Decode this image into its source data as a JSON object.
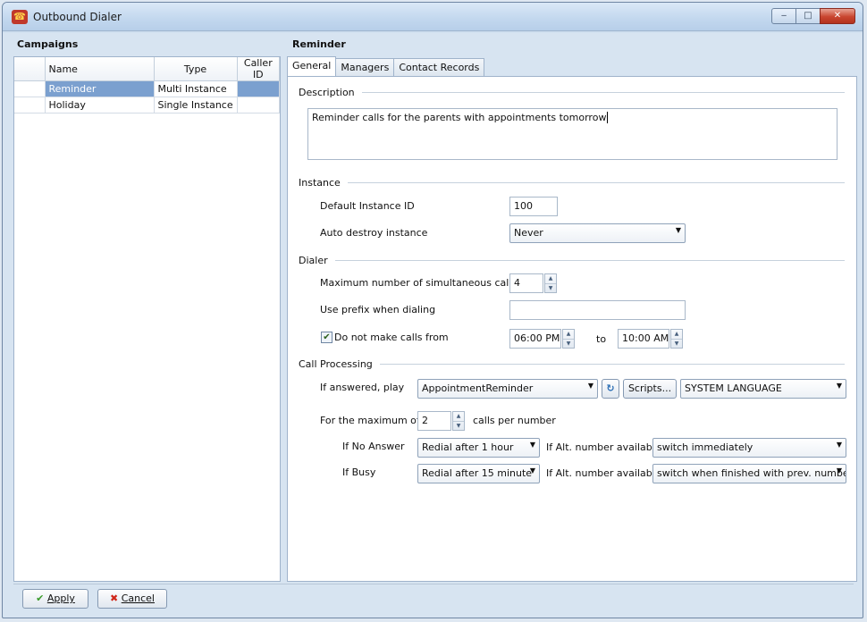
{
  "window": {
    "title": "Outbound Dialer",
    "controls": {
      "minimize": "‒",
      "maximize": "□",
      "close": "✕"
    }
  },
  "campaigns": {
    "heading": "Campaigns",
    "columns": [
      "Name",
      "Type",
      "Caller ID"
    ],
    "rows": [
      {
        "name": "Reminder",
        "type": "Multi Instance",
        "caller_id": ""
      },
      {
        "name": "Holiday",
        "type": "Single Instance",
        "caller_id": ""
      }
    ]
  },
  "detail": {
    "heading": "Reminder",
    "tabs": [
      "General",
      "Managers",
      "Contact Records"
    ],
    "description_group": "Description",
    "description_text": "Reminder calls for the parents with appointments tomorrow",
    "instance_group": "Instance",
    "default_instance_label": "Default Instance ID",
    "default_instance_value": "100",
    "auto_destroy_label": "Auto destroy instance",
    "auto_destroy_value": "Never",
    "dialer_group": "Dialer",
    "max_calls_label": "Maximum number of simultaneous calls",
    "max_calls_value": "4",
    "prefix_label": "Use prefix when dialing",
    "prefix_value": "",
    "no_calls_label": "Do not make calls from",
    "no_calls_checked": true,
    "from_time": "06:00 PM",
    "to_label": "to",
    "to_time": "10:00 AM",
    "call_processing_group": "Call Processing",
    "if_answered_label": "If answered, play",
    "answered_script": "AppointmentReminder",
    "scripts_button": "Scripts...",
    "language_value": "SYSTEM LANGUAGE",
    "max_of_label": "For the maximum of",
    "max_of_value": "2",
    "calls_per_number": "calls per number",
    "no_answer_label": "If No Answer",
    "no_answer_value": "Redial after 1 hour",
    "alt_number_label": "If Alt. number available",
    "no_answer_alt_value": "switch immediately",
    "busy_label": "If Busy",
    "busy_value": "Redial after 15 minute",
    "busy_alt_label": "If Alt. number available",
    "busy_alt_value": "switch when finished with prev. number"
  },
  "footer": {
    "apply_label": "Apply",
    "cancel_label": "Cancel"
  },
  "colors": {
    "selection": "#7ba0cf",
    "apply_icon": "#3a9b2a",
    "cancel_icon": "#d0281b"
  },
  "icons": {
    "app": "dialer-app-icon",
    "refresh": "refresh-icon",
    "apply": "checkmark-icon",
    "cancel": "x-icon"
  }
}
